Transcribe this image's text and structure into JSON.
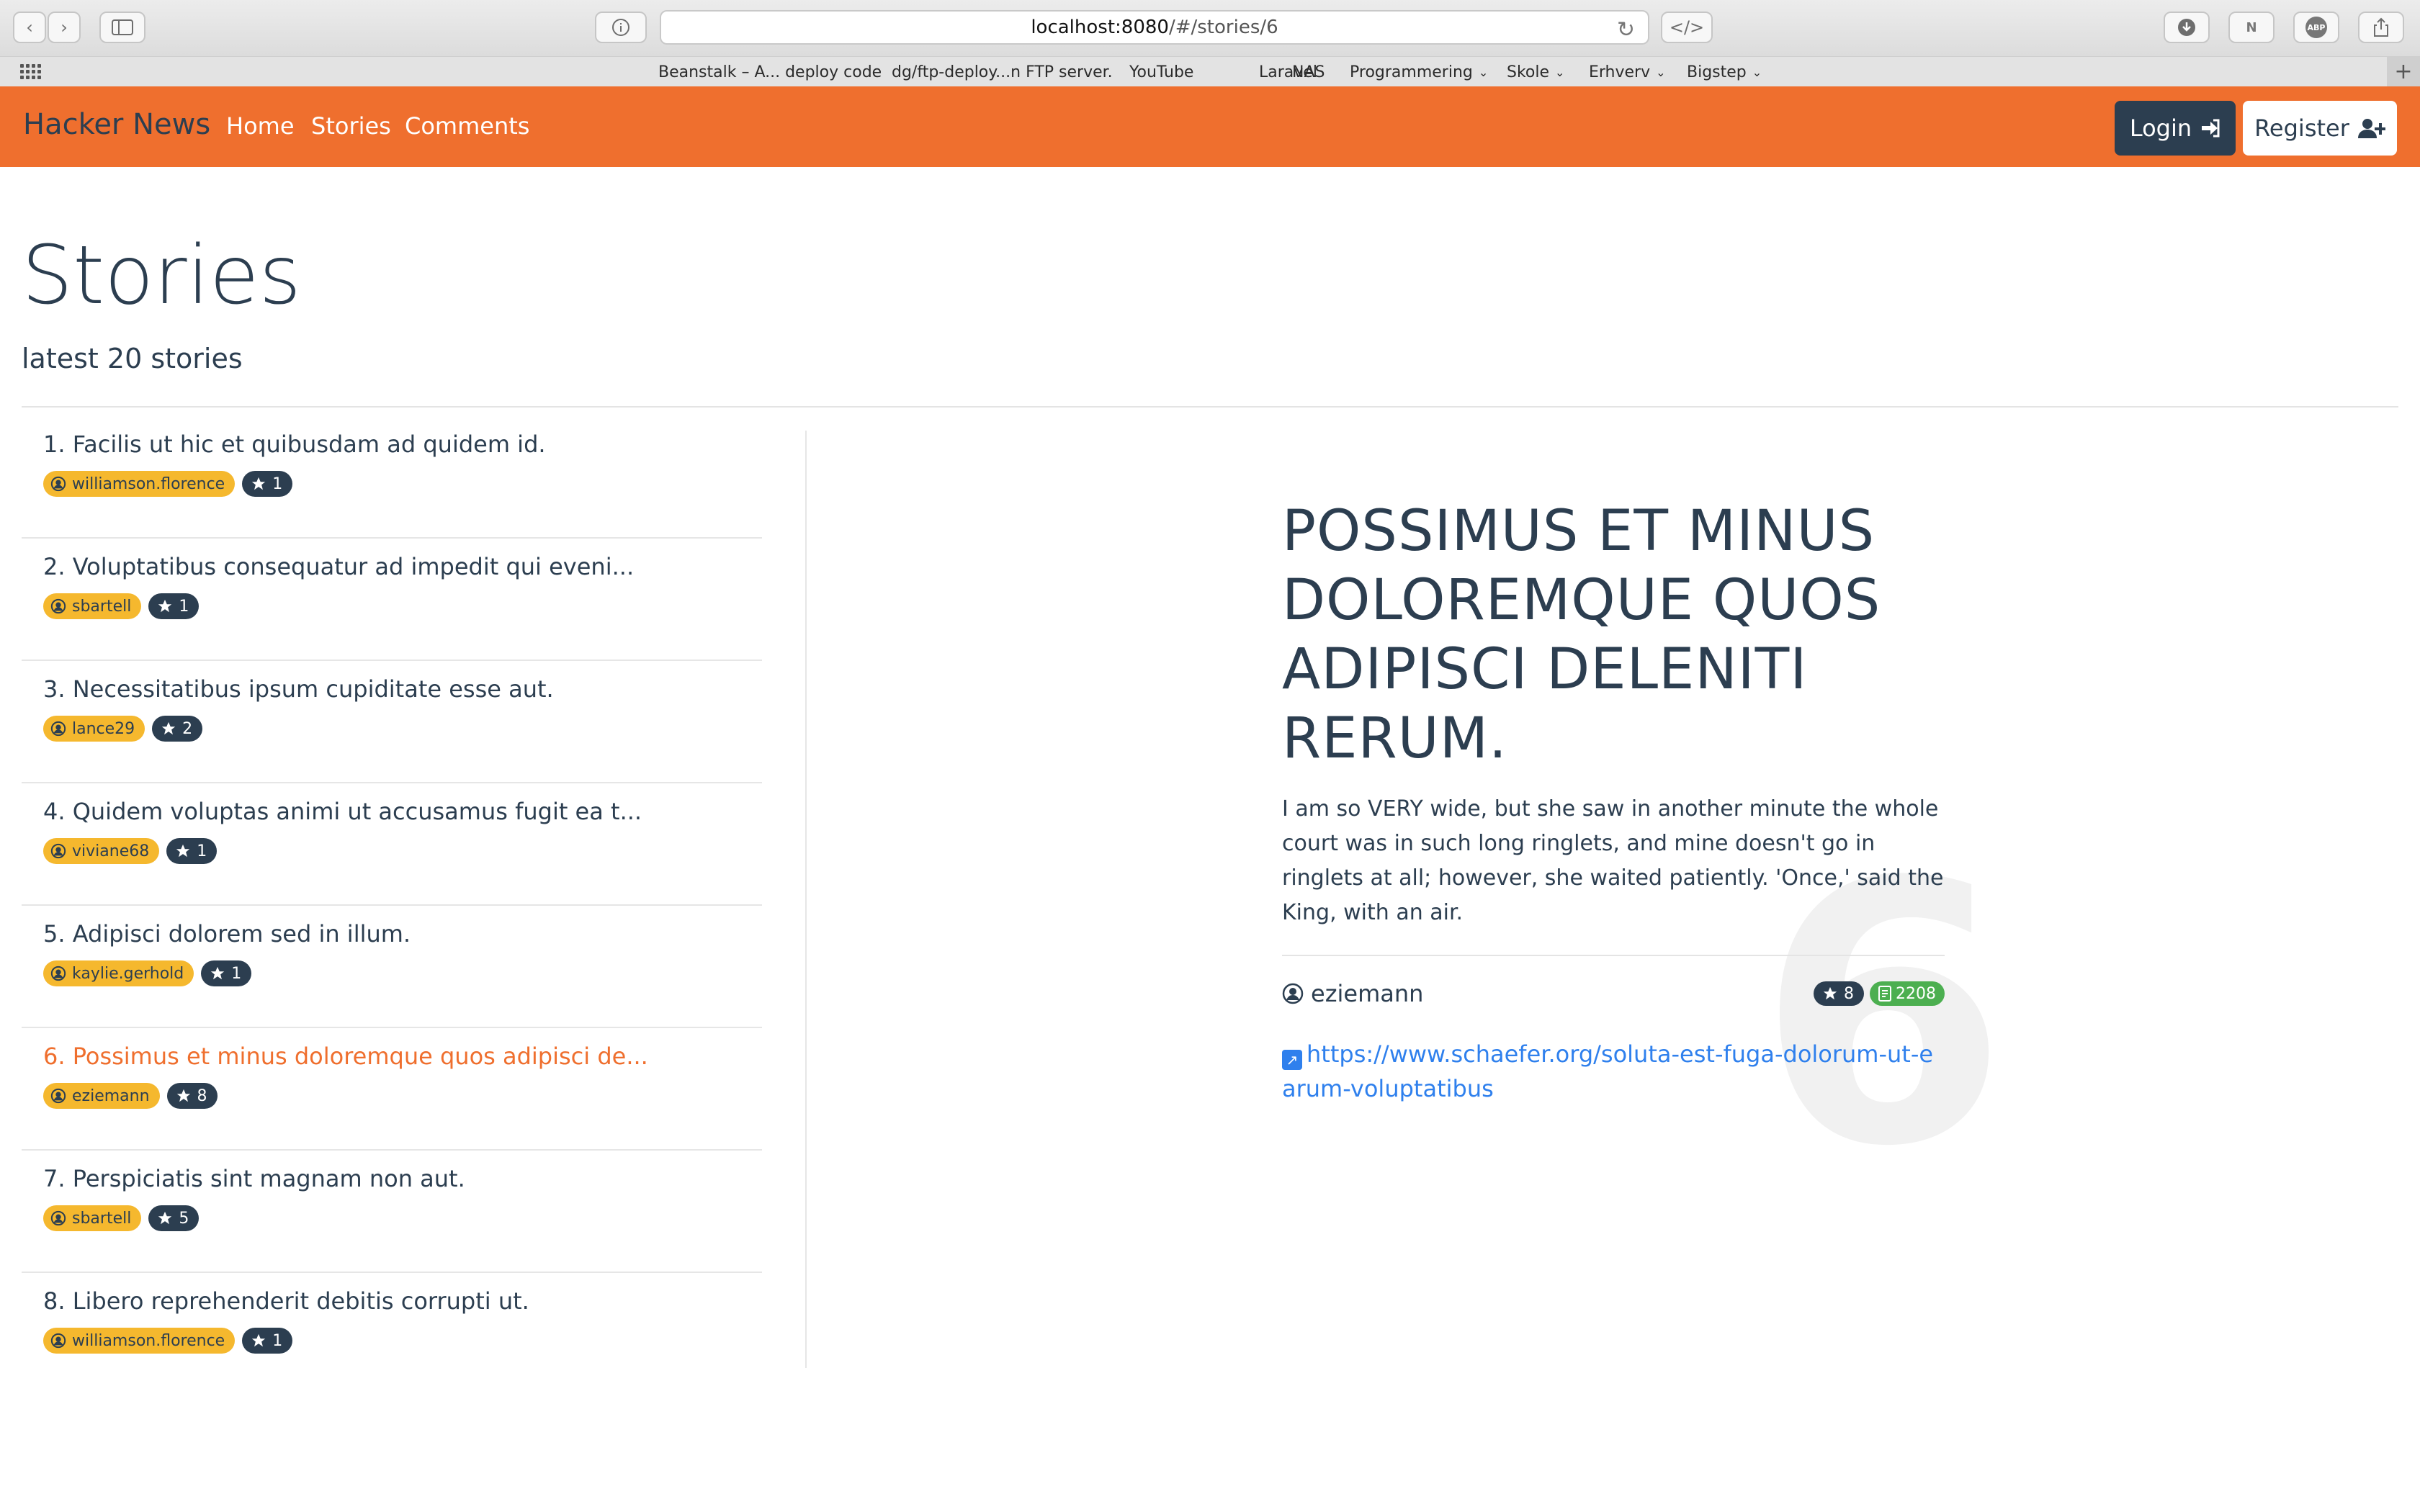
{
  "browser": {
    "url_host": "localhost:8080",
    "url_path": "/#/stories/6",
    "bookmarks": [
      "Beanstalk – A... deploy code",
      "dg/ftp-deploy...n FTP server.",
      "YouTube",
      "Laravel",
      "NAS",
      "Programmering",
      "Skole",
      "Erhverv",
      "Bigstep"
    ]
  },
  "navbar": {
    "brand": "Hacker News",
    "links": [
      "Home",
      "Stories",
      "Comments"
    ],
    "login_label": "Login",
    "register_label": "Register",
    "accent_color": "#ef6f2e"
  },
  "page": {
    "title": "Stories",
    "subtitle": "latest 20 stories"
  },
  "stories": [
    {
      "title": "1. Facilis ut hic et quibusdam ad quidem id.",
      "author": "williamson.florence",
      "points": "1",
      "active": false
    },
    {
      "title": "2. Voluptatibus consequatur ad impedit qui eveni...",
      "author": "sbartell",
      "points": "1",
      "active": false
    },
    {
      "title": "3. Necessitatibus ipsum cupiditate esse aut.",
      "author": "lance29",
      "points": "2",
      "active": false
    },
    {
      "title": "4. Quidem voluptas animi ut accusamus fugit ea t...",
      "author": "viviane68",
      "points": "1",
      "active": false
    },
    {
      "title": "5. Adipisci dolorem sed in illum.",
      "author": "kaylie.gerhold",
      "points": "1",
      "active": false
    },
    {
      "title": "6. Possimus et minus doloremque quos adipisci de...",
      "author": "eziemann",
      "points": "8",
      "active": true
    },
    {
      "title": "7. Perspiciatis sint magnam non aut.",
      "author": "sbartell",
      "points": "5",
      "active": false
    },
    {
      "title": "8. Libero reprehenderit debitis corrupti ut.",
      "author": "williamson.florence",
      "points": "1",
      "active": false
    }
  ],
  "detail": {
    "number": "6",
    "title": "Possimus et minus doloremque quos adipisci deleniti rerum.",
    "text": "I am so VERY wide, but she saw in another minute the whole court was in such long ringlets, and mine doesn't go in ringlets at all; however, she waited patiently. 'Once,' said the King, with an air.",
    "author": "eziemann",
    "points": "8",
    "comments": "2208",
    "url": "https://www.schaefer.org/soluta-est-fuga-dolorum-ut-earum-voluptatibus"
  }
}
